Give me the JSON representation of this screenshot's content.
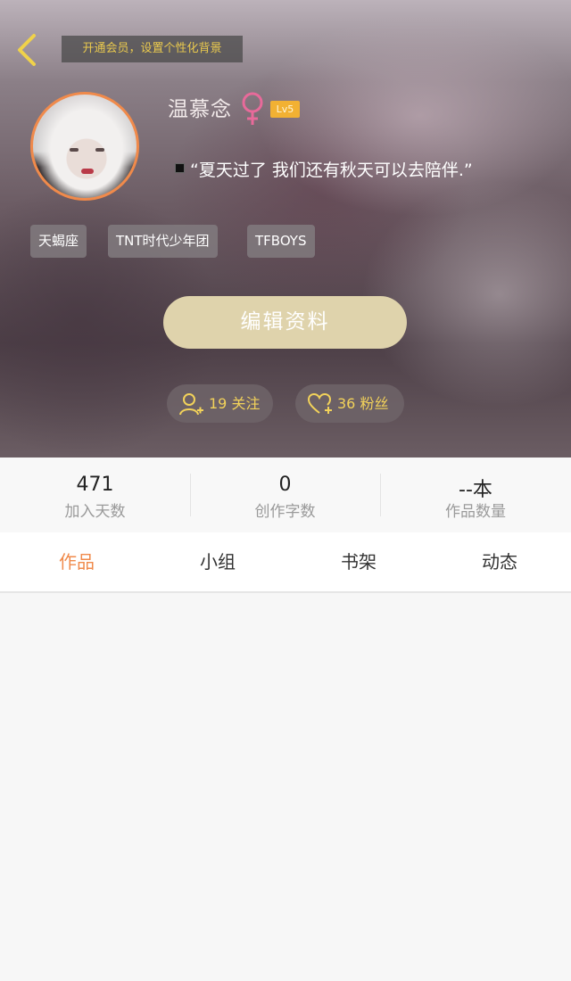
{
  "header": {
    "vip_banner": "开通会员，设置个性化背景"
  },
  "profile": {
    "name": "温慕念",
    "gender": "female",
    "level": "Lv5",
    "signature": "“夏天过了  我们还有秋天可以去陪伴.”",
    "tags": [
      "天蝎座",
      "TNT时代少年团",
      "TFBOYS"
    ],
    "edit_button": "编辑资料",
    "follow_count": "19",
    "follow_label": "关注",
    "fans_count": "36",
    "fans_label": "粉丝"
  },
  "stats": [
    {
      "value": "471",
      "label": "加入天数"
    },
    {
      "value": "0",
      "label": "创作字数"
    },
    {
      "value": "--本",
      "label": "作品数量"
    }
  ],
  "tabs": [
    {
      "label": "作品",
      "active": true
    },
    {
      "label": "小组",
      "active": false
    },
    {
      "label": "书架",
      "active": false
    },
    {
      "label": "动态",
      "active": false
    }
  ],
  "colors": {
    "accent": "#f08a4b",
    "gold": "#f2d25a",
    "button": "#dfd3ac",
    "level_badge": "#f2b133",
    "gender_icon": "#e86a9a"
  }
}
